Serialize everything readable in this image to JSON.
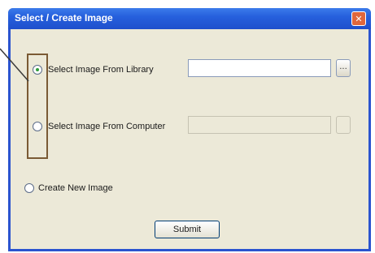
{
  "window": {
    "title": "Select / Create Image",
    "close_symbol": "✕"
  },
  "options": {
    "library_label": "Select Image From Library",
    "computer_label": "Select Image From Computer",
    "create_label": "Create New Image"
  },
  "browse": {
    "library_symbol": "..."
  },
  "buttons": {
    "submit_label": "Submit"
  },
  "colors": {
    "titlebar": "#2660dd",
    "window_bg": "#ece9d8",
    "annotation": "#7a5a34",
    "radio_selected": "#2f9d3a"
  }
}
